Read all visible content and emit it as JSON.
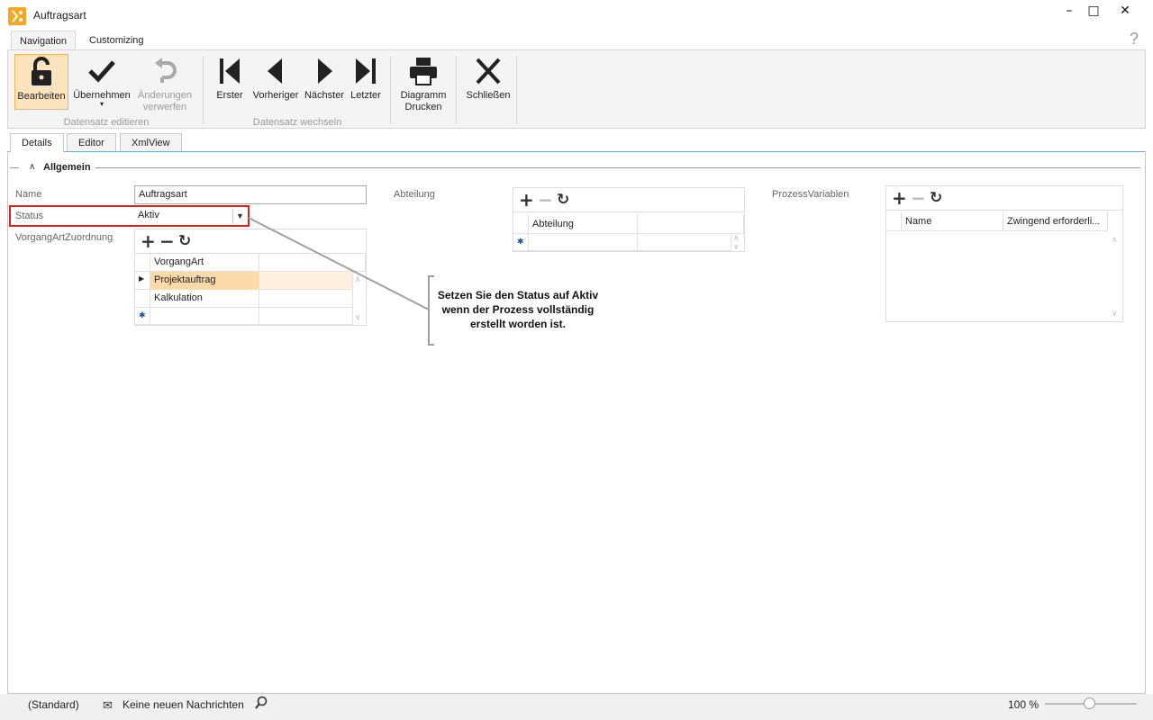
{
  "window": {
    "title": "Auftragsart",
    "minimize": "–",
    "maximize": "□",
    "close": "✕"
  },
  "ribbon_tabs": [
    {
      "label": "Navigation"
    },
    {
      "label": "Customizing"
    }
  ],
  "help": "?",
  "ribbon": {
    "edit_buttons": [
      {
        "label": "Bearbeiten",
        "icon": "lock-open-icon"
      },
      {
        "label": "Übernehmen",
        "icon": "checkmark-icon"
      },
      {
        "label": "Änderungen verwerfen",
        "icon": "undo-icon"
      }
    ],
    "edit_group": "Datensatz editieren",
    "nav_buttons": [
      {
        "label": "Erster",
        "icon": "first-icon"
      },
      {
        "label": "Vorheriger",
        "icon": "previous-icon"
      },
      {
        "label": "Nächster",
        "icon": "next-icon"
      },
      {
        "label": "Letzter",
        "icon": "last-icon"
      }
    ],
    "nav_group": "Datensatz wechseln",
    "print_button": "Diagramm Drucken",
    "close_button": "Schließen"
  },
  "content_tabs": [
    {
      "label": "Details"
    },
    {
      "label": "Editor"
    },
    {
      "label": "XmlView"
    }
  ],
  "group": {
    "title": "Allgemein"
  },
  "form": {
    "name_label": "Name",
    "name_value": "Auftragsart",
    "status_label": "Status",
    "status_value": "Aktiv",
    "vorgang_label": "VorgangArtZuordnung",
    "vorgang_header": "VorgangArt",
    "vorgang_rows": [
      "Projektauftrag",
      "Kalkulation"
    ],
    "abteilung_label": "Abteilung",
    "abteilung_header": "Abteilung",
    "prozess_label": "ProzessVariablen",
    "prozess_headers": [
      "Name",
      "Zwingend erforderli..."
    ]
  },
  "callout": "Setzen Sie den Status auf Aktiv wenn der Prozess vollständig erstellt worden ist.",
  "statusbar": {
    "profile": "(Standard)",
    "messages": "Keine neuen Nachrichten",
    "zoom": "100 %"
  },
  "colors": {
    "accent_orange": "#f5a623",
    "callout_red": "#d9241b",
    "selection": "#fbd9a8"
  }
}
